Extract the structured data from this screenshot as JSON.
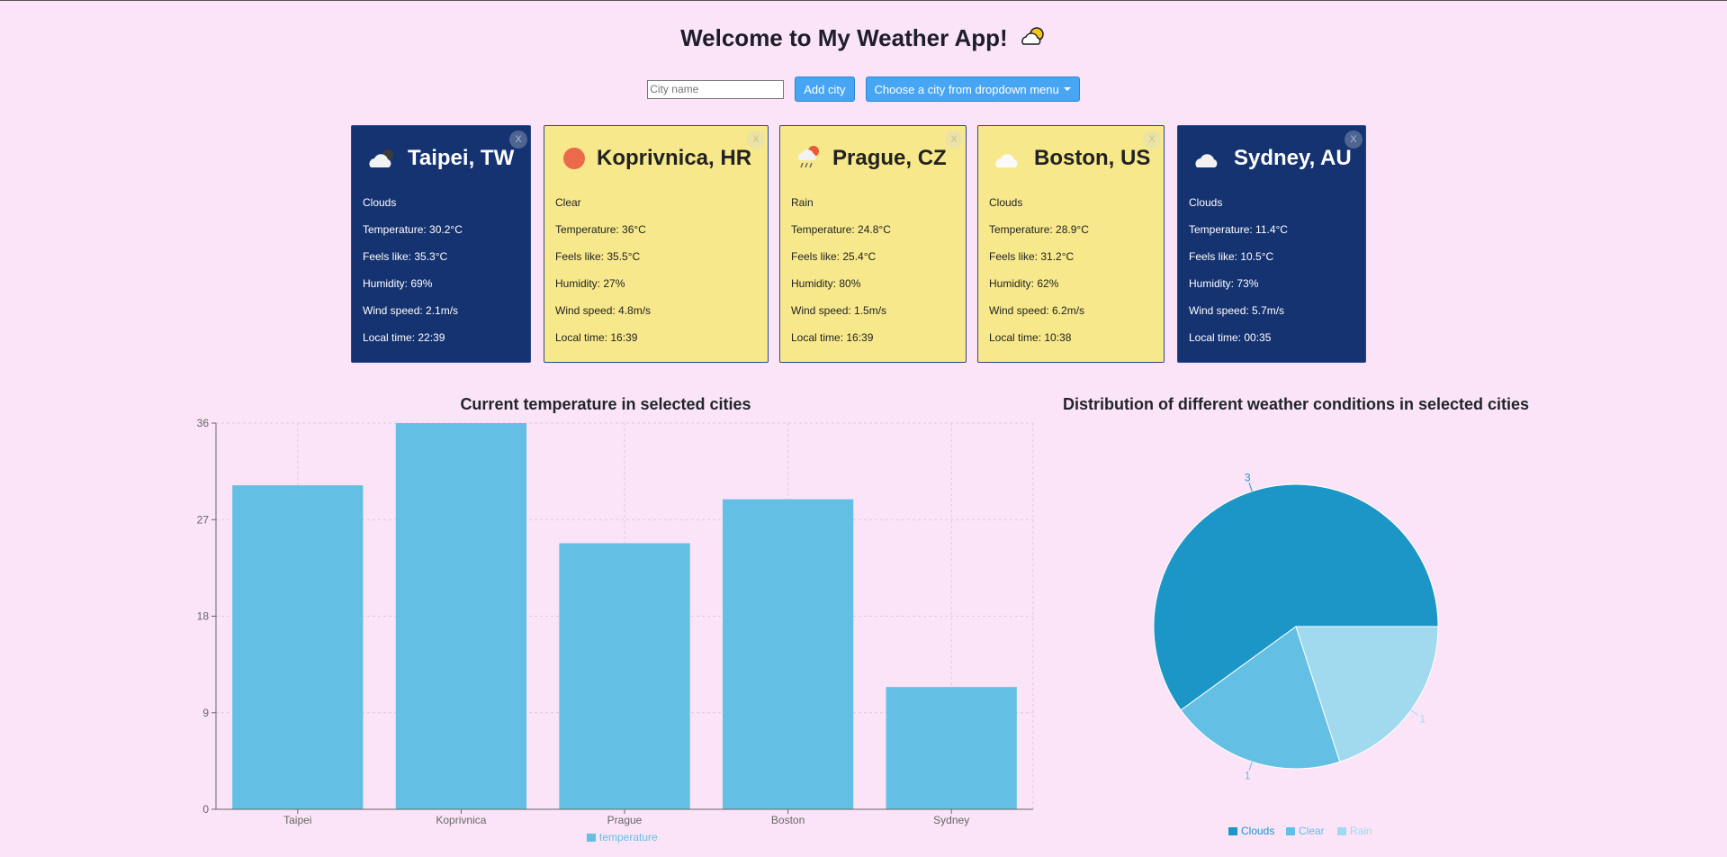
{
  "header": {
    "title": "Welcome to My Weather App!",
    "icon": "sun-behind-cloud-icon"
  },
  "controls": {
    "city_input_placeholder": "City name",
    "city_input_value": "",
    "add_button": "Add city",
    "dropdown_button": "Choose a city from dropdown menu"
  },
  "cards": [
    {
      "city": "Taipei, TW",
      "condition": "Clouds",
      "icon": "cloud-icon",
      "theme": "dark",
      "temperature": "Temperature: 30.2°C",
      "feels_like": "Feels like: 35.3°C",
      "humidity": "Humidity: 69%",
      "wind": "Wind speed: 2.1m/s",
      "local_time": "Local time: 22:39",
      "close": "X"
    },
    {
      "city": "Koprivnica, HR",
      "condition": "Clear",
      "icon": "sun-icon",
      "theme": "light",
      "temperature": "Temperature: 36°C",
      "feels_like": "Feels like: 35.5°C",
      "humidity": "Humidity: 27%",
      "wind": "Wind speed: 4.8m/s",
      "local_time": "Local time: 16:39",
      "close": "X"
    },
    {
      "city": "Prague, CZ",
      "condition": "Rain",
      "icon": "rain-cloud-sun-icon",
      "theme": "light",
      "temperature": "Temperature: 24.8°C",
      "feels_like": "Feels like: 25.4°C",
      "humidity": "Humidity: 80%",
      "wind": "Wind speed: 1.5m/s",
      "local_time": "Local time: 16:39",
      "close": "X"
    },
    {
      "city": "Boston, US",
      "condition": "Clouds",
      "icon": "cloud-icon",
      "theme": "light",
      "temperature": "Temperature: 28.9°C",
      "feels_like": "Feels like: 31.2°C",
      "humidity": "Humidity: 62%",
      "wind": "Wind speed: 6.2m/s",
      "local_time": "Local time: 10:38",
      "close": "X"
    },
    {
      "city": "Sydney, AU",
      "condition": "Clouds",
      "icon": "cloud-icon",
      "theme": "dark",
      "temperature": "Temperature: 11.4°C",
      "feels_like": "Feels like: 10.5°C",
      "humidity": "Humidity: 73%",
      "wind": "Wind speed: 5.7m/s",
      "local_time": "Local time: 00:35",
      "close": "X"
    }
  ],
  "colors": {
    "background": "#fbe4f7",
    "card_dark": "#153271",
    "card_light": "#f7e98b",
    "button": "#47a6f4",
    "bar": "#63c0e4",
    "pie_clouds": "#1c96c6",
    "pie_clear": "#63c0e4",
    "pie_rain": "#a1d9ee"
  },
  "chart_data": [
    {
      "type": "bar",
      "title": "Current temperature in selected cities",
      "categories": [
        "Taipei",
        "Koprivnica",
        "Prague",
        "Boston",
        "Sydney"
      ],
      "series": [
        {
          "name": "temperature",
          "values": [
            30.2,
            36,
            24.8,
            28.9,
            11.4
          ]
        }
      ],
      "ylim": [
        0,
        36
      ],
      "yticks": [
        "0",
        "9",
        "18",
        "27",
        "36"
      ],
      "grid": true,
      "legend": "bottom"
    },
    {
      "type": "pie",
      "title": "Distribution of different weather conditions in selected cities",
      "labels": [
        "Clouds",
        "Clear",
        "Rain"
      ],
      "values": [
        3,
        1,
        1
      ],
      "value_labels": [
        "3",
        "1",
        "1"
      ],
      "legend": "bottom"
    }
  ]
}
